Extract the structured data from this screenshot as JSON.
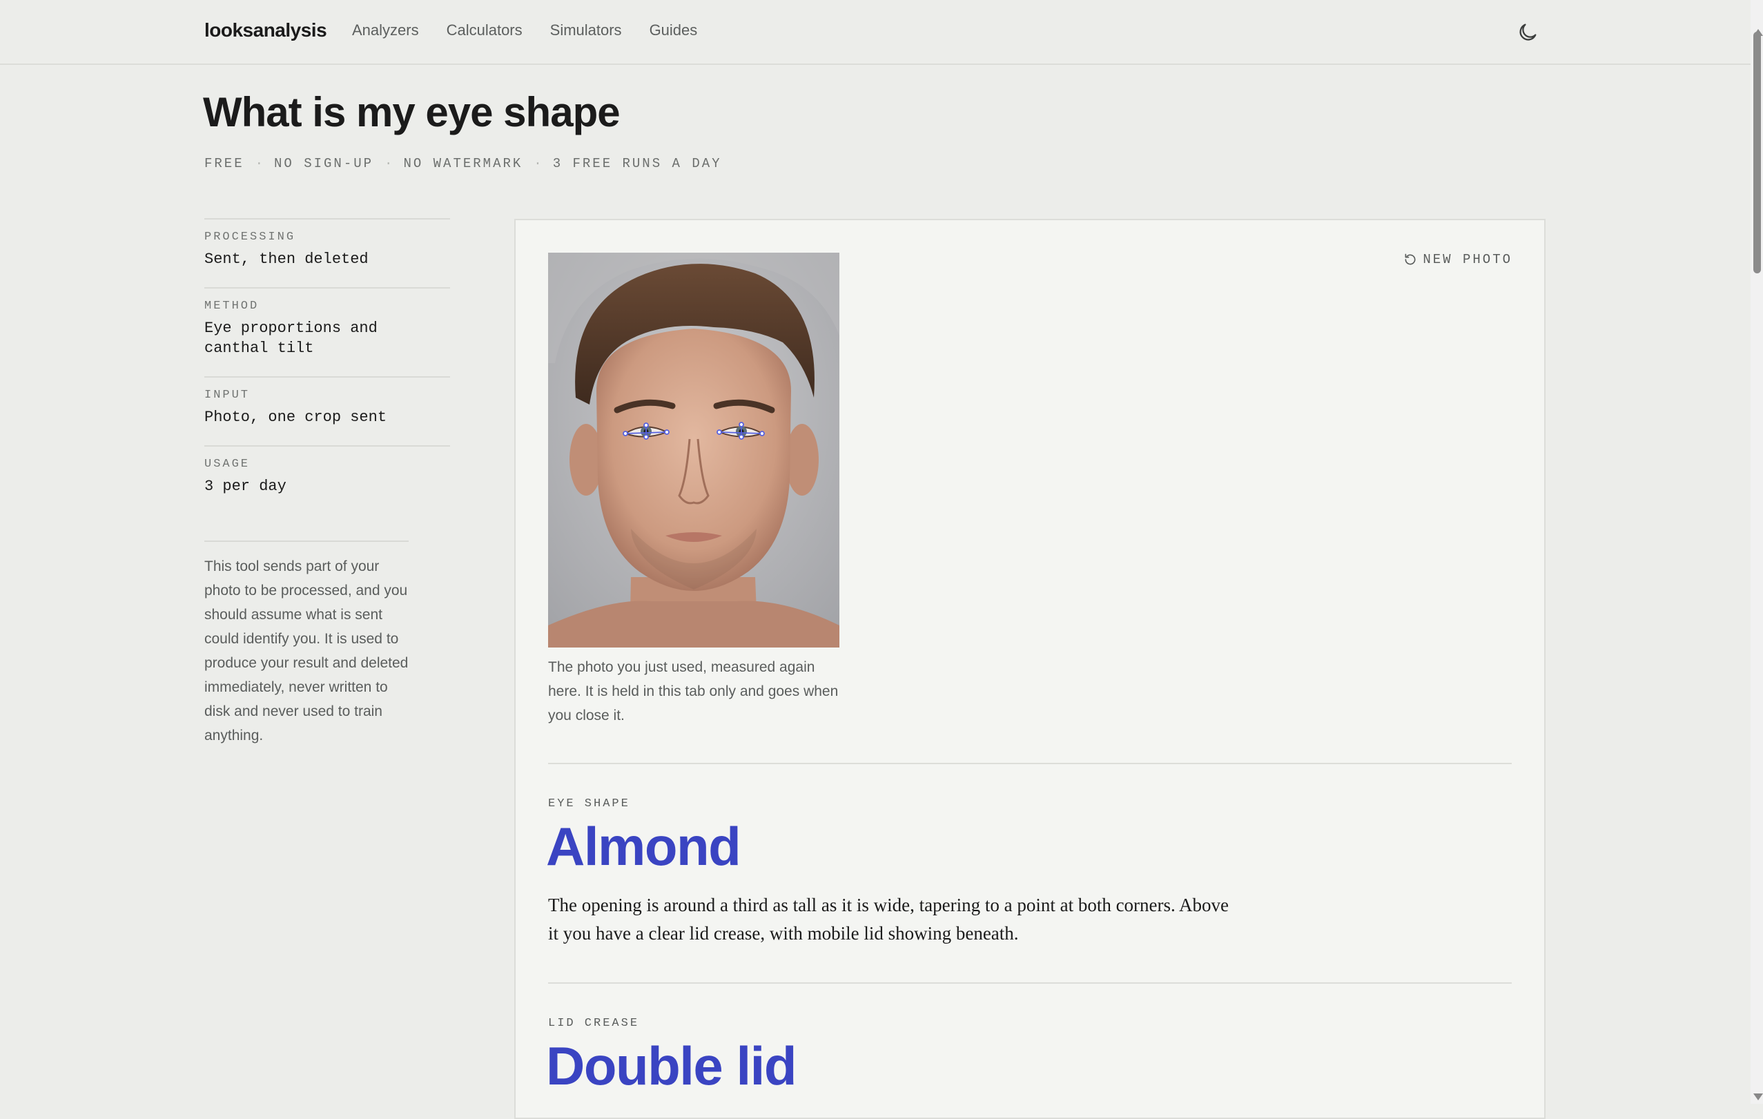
{
  "header": {
    "brand": "looksanalysis",
    "nav": [
      "Analyzers",
      "Calculators",
      "Simulators",
      "Guides"
    ],
    "theme_icon": "moon-icon"
  },
  "page": {
    "title": "What is my eye shape",
    "tags": [
      "FREE",
      "NO SIGN-UP",
      "NO WATERMARK",
      "3 FREE RUNS A DAY"
    ]
  },
  "meta": {
    "items": [
      {
        "label": "PROCESSING",
        "value": "Sent, then deleted"
      },
      {
        "label": "METHOD",
        "value": "Eye proportions and canthal tilt"
      },
      {
        "label": "INPUT",
        "value": "Photo, one crop sent"
      },
      {
        "label": "USAGE",
        "value": "3 per day"
      }
    ],
    "privacy_note": "This tool sends part of your photo to be processed, and you should assume what is sent could identify you. It is used to produce your result and deleted immediately, never written to disk and never used to train anything."
  },
  "result_card": {
    "new_photo_label": "NEW PHOTO",
    "new_photo_icon": "refresh-icon",
    "photo_caption": "The photo you just used, measured again here. It is held in this tab only and goes when you close it.",
    "eye_shape": {
      "label": "EYE SHAPE",
      "value": "Almond",
      "description": "The opening is around a third as tall as it is wide, tapering to a point at both corners. Above it you have a clear lid crease, with mobile lid showing beneath."
    },
    "lid_crease": {
      "label": "LID CREASE",
      "value": "Double lid"
    }
  },
  "colors": {
    "background": "#ecedea",
    "card": "#f4f5f2",
    "accent": "#3a44c2",
    "text": "#1b1b1b",
    "muted": "#5a5d5c",
    "landmark": "#5661e0"
  }
}
